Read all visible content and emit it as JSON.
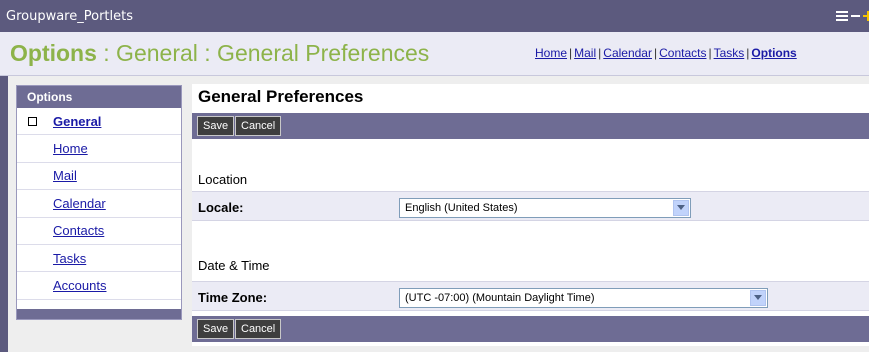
{
  "portlet": {
    "title": "Groupware_Portlets"
  },
  "header": {
    "title_part1": "Options",
    "title_part2": " : General : General Preferences",
    "nav": [
      {
        "label": "Home"
      },
      {
        "label": "Mail"
      },
      {
        "label": "Calendar"
      },
      {
        "label": "Contacts"
      },
      {
        "label": "Tasks"
      },
      {
        "label": "Options"
      }
    ],
    "nav_separator": "|"
  },
  "sidebar": {
    "header": "Options",
    "items": [
      {
        "label": "General",
        "selected": true
      },
      {
        "label": "Home"
      },
      {
        "label": "Mail"
      },
      {
        "label": "Calendar"
      },
      {
        "label": "Contacts"
      },
      {
        "label": "Tasks"
      },
      {
        "label": "Accounts"
      }
    ]
  },
  "main": {
    "title": "General Preferences",
    "buttons": {
      "save": "Save",
      "cancel": "Cancel"
    },
    "location": {
      "heading": "Location",
      "locale_label": "Locale:",
      "locale_value": "English (United States)"
    },
    "datetime": {
      "heading": "Date & Time",
      "timezone_label": "Time Zone:",
      "timezone_value": "(UTC -07:00) (Mountain Daylight Time)"
    }
  },
  "colors": {
    "titlebar": "#5c5a7e",
    "accent_green": "#8db34a",
    "bar_purple": "#6e6c94",
    "link_blue": "#1a1aa6"
  },
  "icons": [
    "list-icon",
    "minimize-icon",
    "maximize-icon",
    "bullet-square-icon",
    "dropdown-arrow-icon"
  ]
}
